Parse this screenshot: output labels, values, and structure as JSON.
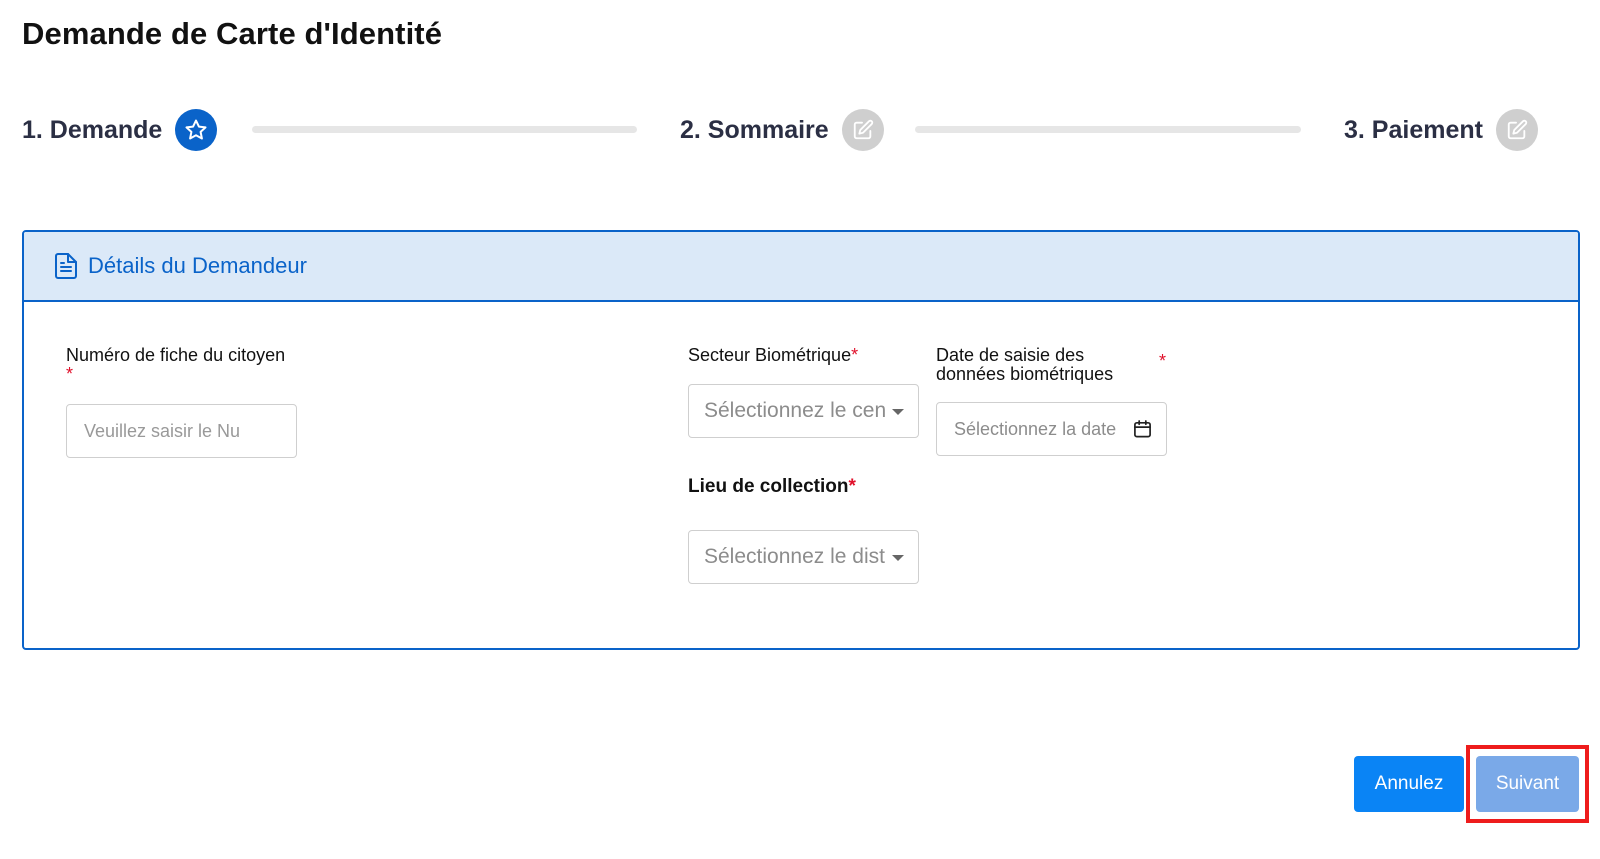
{
  "page": {
    "title": "Demande de Carte d'Identité"
  },
  "stepper": {
    "steps": [
      {
        "label": "1. Demande",
        "icon": "star-icon",
        "state": "active"
      },
      {
        "label": "2. Sommaire",
        "icon": "edit-icon",
        "state": "inactive"
      },
      {
        "label": "3. Paiement",
        "icon": "edit-icon",
        "state": "inactive"
      }
    ]
  },
  "card": {
    "icon": "document-icon",
    "title": "Détails du Demandeur"
  },
  "form": {
    "citizen_number": {
      "label": "Numéro de fiche du citoyen",
      "required_mark": "*",
      "placeholder": "Veuillez saisir le Nu"
    },
    "biometric_sector": {
      "label": "Secteur Biométrique",
      "required_mark": "*",
      "placeholder": "Sélectionnez le centre"
    },
    "biometric_date": {
      "label_line1": "Date de saisie des",
      "label_line2": "données biométriques",
      "required_mark": "*",
      "placeholder": "Sélectionnez la date",
      "icon": "calendar-icon"
    },
    "collection_place": {
      "label": "Lieu de collection",
      "required_mark": "*",
      "placeholder": "Sélectionnez le district"
    }
  },
  "actions": {
    "cancel_label": "Annulez",
    "next_label": "Suivant"
  },
  "colors": {
    "primary": "#0a63c9",
    "cancel_button": "#0a84f5",
    "next_button": "#7aa9e8",
    "required": "#e0102a",
    "highlight": "#ee1c1c"
  }
}
